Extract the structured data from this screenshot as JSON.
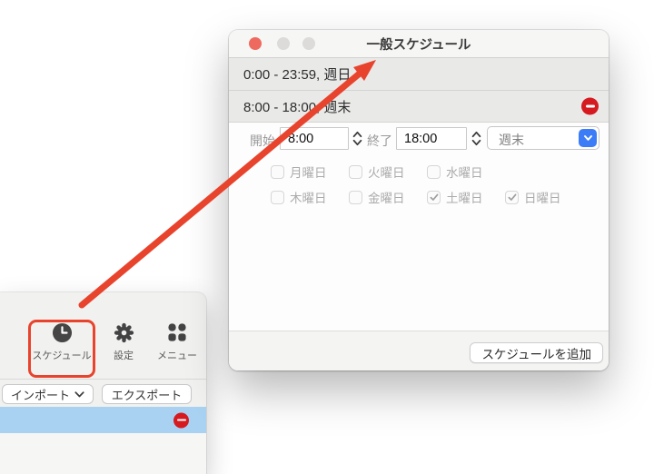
{
  "dialog": {
    "title": "一般スケジュール",
    "rows": [
      {
        "text": "0:00 - 23:59, 週日",
        "deletable": false
      },
      {
        "text": "8:00 - 18:00, 週末",
        "deletable": true
      }
    ],
    "editor": {
      "start_label": "開始",
      "start_value": "8:00",
      "end_label": "終了",
      "end_value": "18:00",
      "period_value": "週末",
      "weekdays": [
        {
          "label": "月曜日",
          "checked": false
        },
        {
          "label": "火曜日",
          "checked": false
        },
        {
          "label": "水曜日",
          "checked": false
        },
        {
          "label": "木曜日",
          "checked": false
        },
        {
          "label": "金曜日",
          "checked": false
        },
        {
          "label": "土曜日",
          "checked": true
        },
        {
          "label": "日曜日",
          "checked": true
        }
      ]
    },
    "footer": {
      "add_button_label": "スケジュールを追加"
    }
  },
  "toolbar_window": {
    "items": [
      {
        "label": "スケジュール",
        "icon": "clock-icon",
        "highlighted": true
      },
      {
        "label": "設定",
        "icon": "gear-icon",
        "highlighted": false
      },
      {
        "label": "メニュー",
        "icon": "menu-grid-icon",
        "highlighted": false
      }
    ],
    "import_button_label": "インポート",
    "export_button_label": "エクスポート"
  },
  "colors": {
    "accent_red": "#e8432d",
    "delete_red": "#d51a20",
    "selection_blue": "#a9d1f1",
    "control_blue": "#3c7df7",
    "traffic_red": "#ee6a5f"
  }
}
